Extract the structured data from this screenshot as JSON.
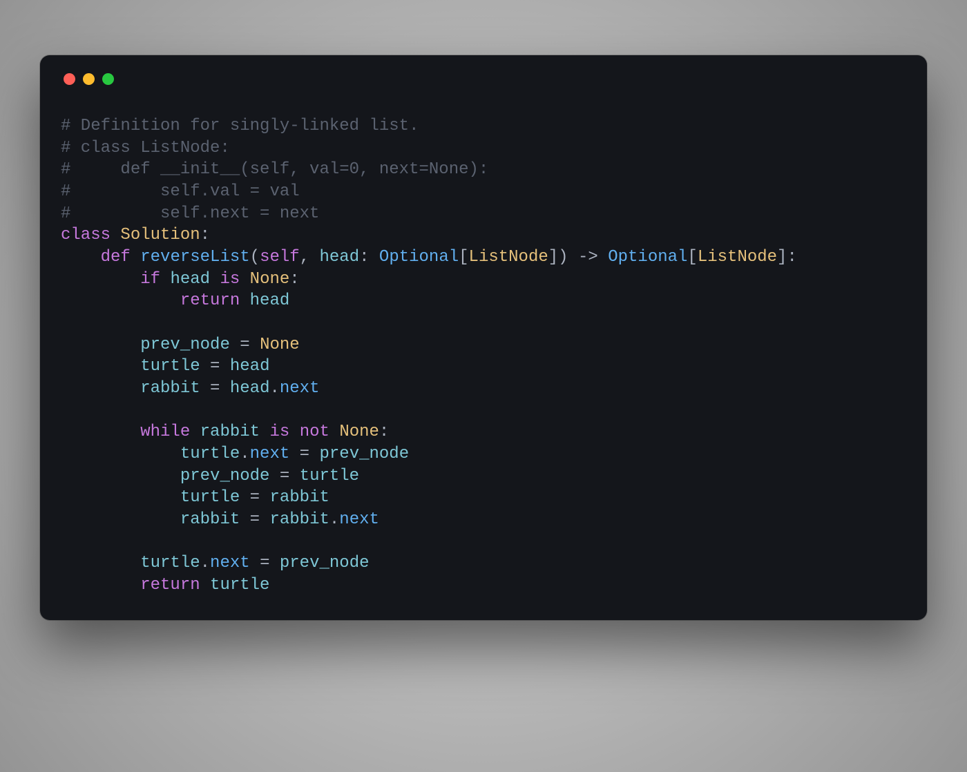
{
  "window": {
    "dots": [
      "red",
      "yellow",
      "green"
    ]
  },
  "code": {
    "tokens": [
      {
        "cls": "tok-comment",
        "text": "# Definition for singly-linked list."
      },
      {
        "br": true
      },
      {
        "cls": "tok-comment",
        "text": "# class ListNode:"
      },
      {
        "br": true
      },
      {
        "cls": "tok-comment",
        "text": "#     def __init__(self, val=0, next=None):"
      },
      {
        "br": true
      },
      {
        "cls": "tok-comment",
        "text": "#         self.val = val"
      },
      {
        "br": true
      },
      {
        "cls": "tok-comment",
        "text": "#         self.next = next"
      },
      {
        "br": true
      },
      {
        "cls": "tok-keyword",
        "text": "class"
      },
      {
        "cls": "tok-punc",
        "text": " "
      },
      {
        "cls": "tok-classname",
        "text": "Solution"
      },
      {
        "cls": "tok-punc",
        "text": ":"
      },
      {
        "br": true
      },
      {
        "cls": "tok-punc",
        "text": "    "
      },
      {
        "cls": "tok-keyword",
        "text": "def"
      },
      {
        "cls": "tok-punc",
        "text": " "
      },
      {
        "cls": "tok-funcname",
        "text": "reverseList"
      },
      {
        "cls": "tok-punc",
        "text": "("
      },
      {
        "cls": "tok-param-self",
        "text": "self"
      },
      {
        "cls": "tok-punc",
        "text": ", "
      },
      {
        "cls": "tok-ident",
        "text": "head"
      },
      {
        "cls": "tok-punc",
        "text": ": "
      },
      {
        "cls": "tok-type",
        "text": "Optional"
      },
      {
        "cls": "tok-punc",
        "text": "["
      },
      {
        "cls": "tok-classname",
        "text": "ListNode"
      },
      {
        "cls": "tok-punc",
        "text": "]) "
      },
      {
        "cls": "tok-op",
        "text": "->"
      },
      {
        "cls": "tok-punc",
        "text": " "
      },
      {
        "cls": "tok-type",
        "text": "Optional"
      },
      {
        "cls": "tok-punc",
        "text": "["
      },
      {
        "cls": "tok-classname",
        "text": "ListNode"
      },
      {
        "cls": "tok-punc",
        "text": "]:"
      },
      {
        "br": true
      },
      {
        "cls": "tok-punc",
        "text": "        "
      },
      {
        "cls": "tok-keyword",
        "text": "if"
      },
      {
        "cls": "tok-punc",
        "text": " "
      },
      {
        "cls": "tok-ident",
        "text": "head"
      },
      {
        "cls": "tok-punc",
        "text": " "
      },
      {
        "cls": "tok-keyword",
        "text": "is"
      },
      {
        "cls": "tok-punc",
        "text": " "
      },
      {
        "cls": "tok-const",
        "text": "None"
      },
      {
        "cls": "tok-punc",
        "text": ":"
      },
      {
        "br": true
      },
      {
        "cls": "tok-punc",
        "text": "            "
      },
      {
        "cls": "tok-ret",
        "text": "return"
      },
      {
        "cls": "tok-punc",
        "text": " "
      },
      {
        "cls": "tok-ident",
        "text": "head"
      },
      {
        "br": true
      },
      {
        "br": true
      },
      {
        "cls": "tok-punc",
        "text": "        "
      },
      {
        "cls": "tok-ident",
        "text": "prev_node"
      },
      {
        "cls": "tok-punc",
        "text": " "
      },
      {
        "cls": "tok-op",
        "text": "="
      },
      {
        "cls": "tok-punc",
        "text": " "
      },
      {
        "cls": "tok-const",
        "text": "None"
      },
      {
        "br": true
      },
      {
        "cls": "tok-punc",
        "text": "        "
      },
      {
        "cls": "tok-ident",
        "text": "turtle"
      },
      {
        "cls": "tok-punc",
        "text": " "
      },
      {
        "cls": "tok-op",
        "text": "="
      },
      {
        "cls": "tok-punc",
        "text": " "
      },
      {
        "cls": "tok-ident",
        "text": "head"
      },
      {
        "br": true
      },
      {
        "cls": "tok-punc",
        "text": "        "
      },
      {
        "cls": "tok-ident",
        "text": "rabbit"
      },
      {
        "cls": "tok-punc",
        "text": " "
      },
      {
        "cls": "tok-op",
        "text": "="
      },
      {
        "cls": "tok-punc",
        "text": " "
      },
      {
        "cls": "tok-ident",
        "text": "head"
      },
      {
        "cls": "tok-punc",
        "text": "."
      },
      {
        "cls": "tok-attr",
        "text": "next"
      },
      {
        "br": true
      },
      {
        "br": true
      },
      {
        "cls": "tok-punc",
        "text": "        "
      },
      {
        "cls": "tok-keyword",
        "text": "while"
      },
      {
        "cls": "tok-punc",
        "text": " "
      },
      {
        "cls": "tok-ident",
        "text": "rabbit"
      },
      {
        "cls": "tok-punc",
        "text": " "
      },
      {
        "cls": "tok-keyword",
        "text": "is"
      },
      {
        "cls": "tok-punc",
        "text": " "
      },
      {
        "cls": "tok-keyword",
        "text": "not"
      },
      {
        "cls": "tok-punc",
        "text": " "
      },
      {
        "cls": "tok-const",
        "text": "None"
      },
      {
        "cls": "tok-punc",
        "text": ":"
      },
      {
        "br": true
      },
      {
        "cls": "tok-punc",
        "text": "            "
      },
      {
        "cls": "tok-ident",
        "text": "turtle"
      },
      {
        "cls": "tok-punc",
        "text": "."
      },
      {
        "cls": "tok-attr",
        "text": "next"
      },
      {
        "cls": "tok-punc",
        "text": " "
      },
      {
        "cls": "tok-op",
        "text": "="
      },
      {
        "cls": "tok-punc",
        "text": " "
      },
      {
        "cls": "tok-ident",
        "text": "prev_node"
      },
      {
        "br": true
      },
      {
        "cls": "tok-punc",
        "text": "            "
      },
      {
        "cls": "tok-ident",
        "text": "prev_node"
      },
      {
        "cls": "tok-punc",
        "text": " "
      },
      {
        "cls": "tok-op",
        "text": "="
      },
      {
        "cls": "tok-punc",
        "text": " "
      },
      {
        "cls": "tok-ident",
        "text": "turtle"
      },
      {
        "br": true
      },
      {
        "cls": "tok-punc",
        "text": "            "
      },
      {
        "cls": "tok-ident",
        "text": "turtle"
      },
      {
        "cls": "tok-punc",
        "text": " "
      },
      {
        "cls": "tok-op",
        "text": "="
      },
      {
        "cls": "tok-punc",
        "text": " "
      },
      {
        "cls": "tok-ident",
        "text": "rabbit"
      },
      {
        "br": true
      },
      {
        "cls": "tok-punc",
        "text": "            "
      },
      {
        "cls": "tok-ident",
        "text": "rabbit"
      },
      {
        "cls": "tok-punc",
        "text": " "
      },
      {
        "cls": "tok-op",
        "text": "="
      },
      {
        "cls": "tok-punc",
        "text": " "
      },
      {
        "cls": "tok-ident",
        "text": "rabbit"
      },
      {
        "cls": "tok-punc",
        "text": "."
      },
      {
        "cls": "tok-attr",
        "text": "next"
      },
      {
        "br": true
      },
      {
        "br": true
      },
      {
        "cls": "tok-punc",
        "text": "        "
      },
      {
        "cls": "tok-ident",
        "text": "turtle"
      },
      {
        "cls": "tok-punc",
        "text": "."
      },
      {
        "cls": "tok-attr",
        "text": "next"
      },
      {
        "cls": "tok-punc",
        "text": " "
      },
      {
        "cls": "tok-op",
        "text": "="
      },
      {
        "cls": "tok-punc",
        "text": " "
      },
      {
        "cls": "tok-ident",
        "text": "prev_node"
      },
      {
        "br": true
      },
      {
        "cls": "tok-punc",
        "text": "        "
      },
      {
        "cls": "tok-ret",
        "text": "return"
      },
      {
        "cls": "tok-punc",
        "text": " "
      },
      {
        "cls": "tok-ident",
        "text": "turtle"
      }
    ]
  }
}
